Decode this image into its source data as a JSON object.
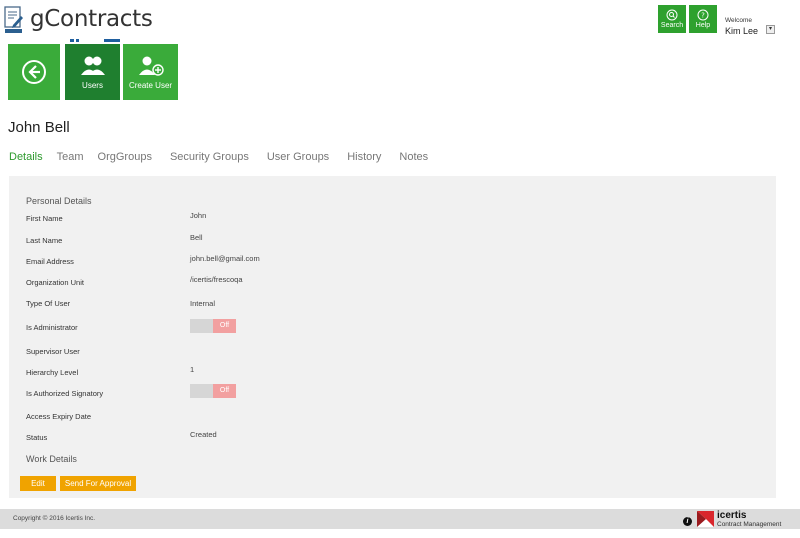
{
  "header": {
    "app_title": "gContracts",
    "search_label": "Search",
    "help_label": "Help",
    "welcome_label": "Welcome",
    "user_name": "Kim Lee"
  },
  "tiles": {
    "users_label": "Users",
    "create_user_label": "Create User"
  },
  "person": {
    "name": "John Bell"
  },
  "tabs": [
    {
      "label": "Details",
      "active": true
    },
    {
      "label": "Team"
    },
    {
      "label": "OrgGroups"
    },
    {
      "label": "Security Groups"
    },
    {
      "label": "User Groups"
    },
    {
      "label": "History"
    },
    {
      "label": "Notes"
    }
  ],
  "details": {
    "section_personal": "Personal Details",
    "section_work": "Work Details",
    "fields": [
      {
        "label": "First Name",
        "value": "John"
      },
      {
        "label": "Last Name",
        "value": "Bell"
      },
      {
        "label": "Email Address",
        "value": "john.bell@gmail.com"
      },
      {
        "label": "Organization Unit",
        "value": "/icertis/frescoqa"
      },
      {
        "label": "Type Of User",
        "value": "Internal"
      },
      {
        "label": "Is Administrator",
        "toggle": "Off"
      },
      {
        "label": "Supervisor User",
        "value": ""
      },
      {
        "label": "Hierarchy Level",
        "value": "1"
      },
      {
        "label": "Is Authorized Signatory",
        "toggle": "Off"
      },
      {
        "label": "Access Expiry Date",
        "value": ""
      },
      {
        "label": "Status",
        "value": "Created"
      }
    ]
  },
  "actions": {
    "edit_label": "Edit",
    "send_for_approval_label": "Send For Approval"
  },
  "footer": {
    "copyright": "Copyright © 2016 Icertis Inc.",
    "brand_name": "icertis",
    "brand_tagline": "Contract Management"
  },
  "colors": {
    "accent_green": "#2ea12e",
    "active_tile_green": "#1f7f2f",
    "button_orange": "#f0a300",
    "toggle_off_pink": "#f2a0a0"
  }
}
